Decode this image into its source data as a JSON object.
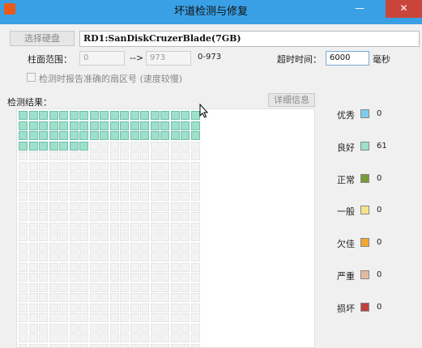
{
  "window": {
    "title": "坏道检测与修复",
    "minimize_glyph": "—",
    "close_glyph": "✕"
  },
  "drive": {
    "select_button": "选择硬盘",
    "selected": "RD1:SanDiskCruzerBlade(7GB)"
  },
  "range": {
    "label": "柱面范围：",
    "start": "0",
    "separator": "-->",
    "end": "973",
    "hint": "0-973"
  },
  "timeout": {
    "label": "超时时间：",
    "value": "6000",
    "unit": "毫秒"
  },
  "option": {
    "label": "检测时报告准确的扇区号 (速度较慢)",
    "checked": false
  },
  "results": {
    "label": "检测结果：",
    "details_button": "详细信息"
  },
  "grid": {
    "columns": 18,
    "total_cells": 450,
    "good_cells": 61
  },
  "legend": [
    {
      "label": "优秀",
      "count": "0",
      "color": "#7ecbf0"
    },
    {
      "label": "良好",
      "count": "61",
      "color": "#9ee0cc"
    },
    {
      "label": "正常",
      "count": "0",
      "color": "#7a9a3a"
    },
    {
      "label": "一般",
      "count": "0",
      "color": "#f6e48a"
    },
    {
      "label": "欠佳",
      "count": "0",
      "color": "#f0a830"
    },
    {
      "label": "严重",
      "count": "0",
      "color": "#e3bba3"
    },
    {
      "label": "损坏",
      "count": "0",
      "color": "#c04040"
    }
  ],
  "colors": {
    "titlebar": "#3aa0e6",
    "good_cell": "#9ee0cc",
    "empty_cell": "#f3f3f3"
  }
}
